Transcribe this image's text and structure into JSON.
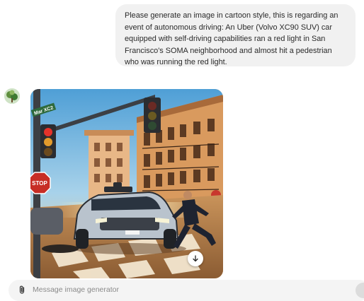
{
  "conversation": {
    "user_message": "Please generate an image in cartoon style, this is regarding an event of autonomous driving: An Uber (Volvo XC90 SUV) car equipped with self-driving capabilities ran a red light in San Francisco's SOMA neighborhood and almost hit a pedestrian who was running the red light.",
    "generated_image": {
      "street_sign": "Mar XC2",
      "stop_sign": "STOP",
      "download_icon": "arrow-down-icon"
    }
  },
  "composer": {
    "placeholder": "Message image generator",
    "value": "",
    "attach_icon": "paperclip-icon"
  },
  "colors": {
    "user_bubble": "#f1f1f1",
    "composer": "#f4f4f4"
  }
}
